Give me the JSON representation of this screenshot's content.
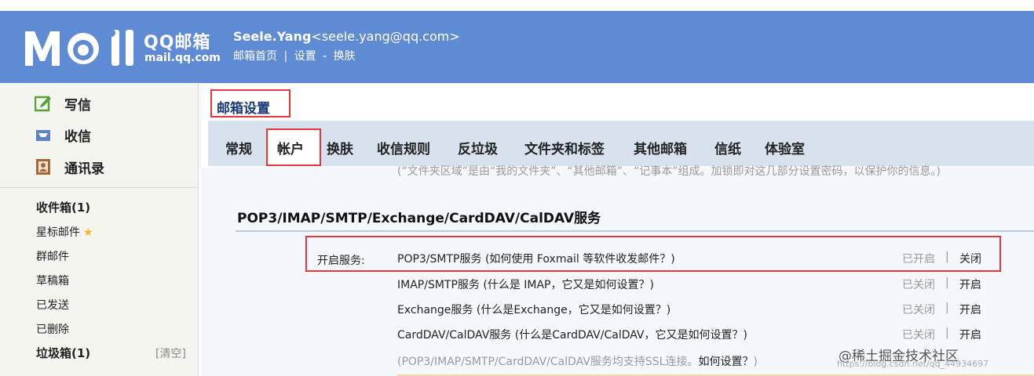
{
  "header": {
    "brand": "QQ邮箱",
    "domain": "mail.qq.com",
    "user_name": "Seele.Yang",
    "user_email": "<seele.yang@qq.com>",
    "home_link": "邮箱首页",
    "sep1": "|",
    "settings_link": "设置",
    "sep2": "-",
    "skin_link": "换肤",
    "colors": {
      "bar": "#5f8bd5"
    }
  },
  "sidebar": {
    "compose": "写信",
    "receive": "收信",
    "contacts": "通讯录",
    "folders": {
      "inbox": "收件箱(1)",
      "starred": "星标邮件",
      "group": "群邮件",
      "drafts": "草稿箱",
      "sent": "已发送",
      "deleted": "已删除",
      "spam": "垃圾箱(1)"
    },
    "clear": "[清空]"
  },
  "settings": {
    "title": "邮箱设置",
    "tabs": {
      "general": "常规",
      "account": "帐户",
      "skin": "换肤",
      "rules": "收信规则",
      "antispam": "反垃圾",
      "folders": "文件夹和标签",
      "other": "其他邮箱",
      "stationery": "信纸",
      "lab": "体验室"
    },
    "active_tab": "帐户"
  },
  "content": {
    "note": "(“文件夹区域”是由“我的文件夹”、“其他邮箱”、“记事本”组成。加锁即对这几部分设置密码，以保护你的信息。)",
    "section_title": "POP3/IMAP/SMTP/Exchange/CardDAV/CalDAV服务",
    "enable_label": "开启服务:",
    "services": [
      {
        "name": "POP3/SMTP服务 (如何使用 Foxmail 等软件收发邮件？)",
        "state": "已开启",
        "sep": "|",
        "action": "关闭"
      },
      {
        "name": "IMAP/SMTP服务 (什么是 IMAP，它又是如何设置？)",
        "state": "已关闭",
        "sep": "|",
        "action": "开启"
      },
      {
        "name": "Exchange服务 (什么是Exchange，它又是如何设置？)",
        "state": "已关闭",
        "sep": "|",
        "action": "开启"
      },
      {
        "name": "CardDAV/CalDAV服务 (什么是CardDAV/CalDAV，它又是如何设置？)",
        "state": "已关闭",
        "sep": "|",
        "action": "开启"
      }
    ],
    "ssl_note": "(POP3/IMAP/SMTP/CardDAV/CalDAV服务均支持SSL连接。",
    "ssl_link": "如何设置？",
    "ssl_close": ")"
  },
  "watermark": {
    "text": "@稀土掘金技术社区",
    "url": "https://blog.csdn.net/qq_44934697"
  },
  "icons": {
    "compose": "edit-icon",
    "receive": "inbox-icon",
    "contacts": "contact-card-icon",
    "starred": "star-icon"
  }
}
